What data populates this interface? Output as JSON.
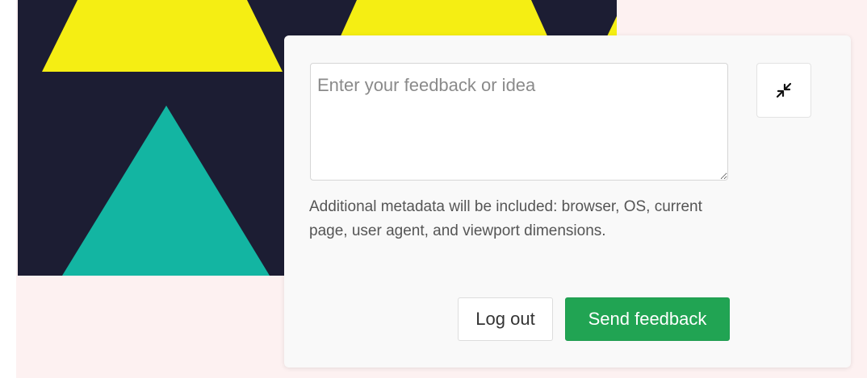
{
  "colors": {
    "page_background": "#fdf1f1",
    "hero_dark": "#1c1d33",
    "hero_yellow": "#f5ee13",
    "hero_teal": "#13b5a2",
    "panel_background": "#f9f9f9",
    "primary_button": "#21a453"
  },
  "feedback": {
    "textarea_placeholder": "Enter your feedback or idea",
    "textarea_value": "",
    "collapse_icon": "collapse-arrows-icon",
    "metadata_note": "Additional metadata will be included: browser, OS, current page, user agent, and viewport dimensions.",
    "logout_label": "Log out",
    "send_label": "Send feedback"
  }
}
